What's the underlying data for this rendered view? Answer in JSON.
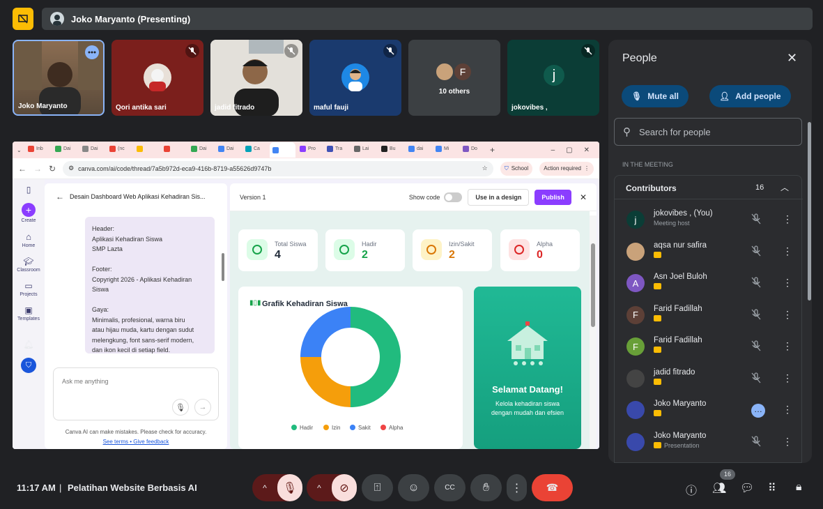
{
  "presenter": {
    "label": "Joko Maryanto (Presenting)"
  },
  "tiles": [
    {
      "name": "Joko Maryanto",
      "color": "#5a4a3a"
    },
    {
      "name": "Qori antika sari",
      "color": "#7b1f1c"
    },
    {
      "name": "jadid fitrado",
      "color": "#d9d6d0"
    },
    {
      "name": "maful fauji",
      "color": "#1a3a6e"
    },
    {
      "name": "10 others",
      "color": "#3c4043"
    },
    {
      "name": "jokovibes ,",
      "color": "#0b3d36",
      "initial": "j"
    }
  ],
  "others_initial": "F",
  "browser": {
    "tabs": [
      "Inb",
      "Dai",
      "Dai",
      "(nc",
      "",
      "",
      "Dai",
      "Dai",
      "Ca",
      "",
      "Pro",
      "Tra",
      "Lai",
      "Bu",
      "dai",
      "Mi",
      "Do"
    ],
    "url": "canva.com/ai/code/thread/7a5b972d-eca9-416b-8719-a55626d9747b",
    "school": "School",
    "action": "Action required"
  },
  "canva": {
    "rail": [
      "Create",
      "Home",
      "Classroom",
      "Projects",
      "Templates"
    ],
    "chat_title": "Desain Dashboard Web Aplikasi Kehadiran Sis...",
    "chat_lines": [
      "Header:",
      "Aplikasi Kehadiran Siswa",
      "SMP Lazta",
      "",
      "Footer:",
      "Copyright 2026 - Aplikasi Kehadiran",
      "Siswa",
      "",
      "Gaya:",
      "Minimalis, profesional, warna biru",
      "atau hijau muda, kartu dengan sudut",
      "melengkung, font sans-serif modern,",
      "dan ikon kecil di setiap field."
    ],
    "ask_placeholder": "Ask me anything",
    "disclaimer": "Canva AI can make mistakes. Please check for accuracy.",
    "links": "See terms • Give feedback",
    "version": "Version 1",
    "show_code": "Show code",
    "use_design": "Use in a design",
    "publish": "Publish"
  },
  "dashboard": {
    "stats": [
      {
        "label": "Total Siswa",
        "value": "4",
        "color": "#1f2937",
        "bg": "#dcfce7",
        "ic": "#16a34a"
      },
      {
        "label": "Hadir",
        "value": "2",
        "color": "#16a34a",
        "bg": "#dcfce7",
        "ic": "#16a34a"
      },
      {
        "label": "Izin/Sakit",
        "value": "2",
        "color": "#d97706",
        "bg": "#fef3c7",
        "ic": "#d97706"
      },
      {
        "label": "Alpha",
        "value": "0",
        "color": "#dc2626",
        "bg": "#fee2e2",
        "ic": "#dc2626"
      }
    ],
    "chart_title": "Grafik Kehadiran Siswa",
    "welcome_title": "Selamat Datang!",
    "welcome_text": "Kelola kehadiran siswa dengan mudah dan efsien"
  },
  "chart_data": {
    "type": "pie",
    "title": "Grafik Kehadiran Siswa",
    "categories": [
      "Hadir",
      "Izin",
      "Sakit",
      "Alpha"
    ],
    "values": [
      2,
      1,
      1,
      0
    ],
    "colors": [
      "#21bb7e",
      "#f59e0b",
      "#3b82f6",
      "#ef4444"
    ],
    "legend": "bottom"
  },
  "people": {
    "title": "People",
    "mute_all": "Mute all",
    "add_people": "Add people",
    "search_placeholder": "Search for people",
    "section": "IN THE MEETING",
    "group": "Contributors",
    "count": "16",
    "rows": [
      {
        "name": "jokovibes , (You)",
        "sub": "Meeting host",
        "initial": "j",
        "color": "#0b3d36"
      },
      {
        "name": "aqsa nur safira",
        "sub": "",
        "initial": "",
        "color": "#c9a27a"
      },
      {
        "name": "Asn Joel Buloh",
        "sub": "",
        "initial": "A",
        "color": "#7e57c2"
      },
      {
        "name": "Farid Fadillah",
        "sub": "",
        "initial": "F",
        "color": "#5d4037"
      },
      {
        "name": "Farid Fadillah",
        "sub": "",
        "initial": "F",
        "color": "#689f38"
      },
      {
        "name": "jadid fitrado",
        "sub": "",
        "initial": "",
        "color": "#444"
      },
      {
        "name": "Joko Maryanto",
        "sub": "",
        "initial": "",
        "color": "#3949ab"
      },
      {
        "name": "Joko Maryanto",
        "sub": "Presentation",
        "initial": "",
        "color": "#3949ab"
      }
    ]
  },
  "bottom": {
    "time": "11:17 AM",
    "separator": "|",
    "meeting": "Pelatihan Website Berbasis AI",
    "people_count": "16"
  }
}
